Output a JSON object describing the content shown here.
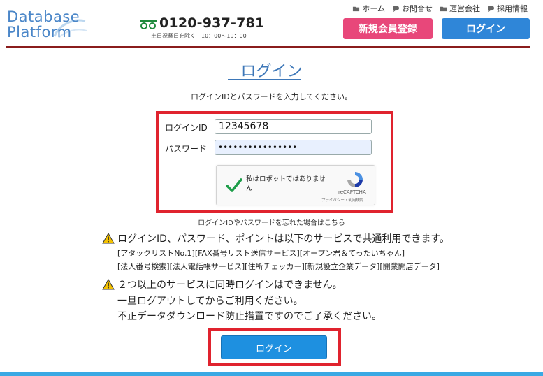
{
  "header": {
    "logo_line1": "Database",
    "logo_line2": "Platform",
    "phone_number": "0120-937-781",
    "phone_hours": "土日祝祭日を除く　10：00～19：00",
    "top_links": [
      {
        "label": "ホーム",
        "icon": "folder-icon"
      },
      {
        "label": "お問合せ",
        "icon": "chat-icon"
      },
      {
        "label": "運営会社",
        "icon": "folder-icon"
      },
      {
        "label": "採用情報",
        "icon": "chat-icon"
      }
    ],
    "register_label": "新規会員登録",
    "login_label": "ログイン"
  },
  "main": {
    "title": "ログイン",
    "instruction": "ログインIDとパスワードを入力してください。",
    "login_id_label": "ログインID",
    "login_id_value": "12345678",
    "password_label": "パスワード",
    "password_value": "••••••••••••••••",
    "recaptcha_text": "私はロボットではありません",
    "recaptcha_brand": "reCAPTCHA",
    "recaptcha_terms": "プライバシー・利用規約",
    "forgot_link": "ログインIDやパスワードを忘れた場合はこちら",
    "notice1_main": "ログインID、パスワード、ポイントは以下のサービスで共通利用できます。",
    "notice1_sub1": "[アタックリストNo.1][FAX番号リスト送信サービス][オープン君＆てったいちゃん]",
    "notice1_sub2": "[法人番号検索][法人電話帳サービス][住所チェッカー][新規設立企業データ][開業開店データ]",
    "notice2_line1": "２つ以上のサービスに同時ログインはできません。",
    "notice2_line2": "一旦ログアウトしてからご利用ください。",
    "notice2_line3": "不正データダウンロード防止措置ですのでご了承ください。",
    "submit_label": "ログイン"
  },
  "colors": {
    "accent_blue": "#2f86d8",
    "register_pink": "#e8477a",
    "highlight_red": "#e0232e",
    "header_rule": "#8a1c1c"
  }
}
